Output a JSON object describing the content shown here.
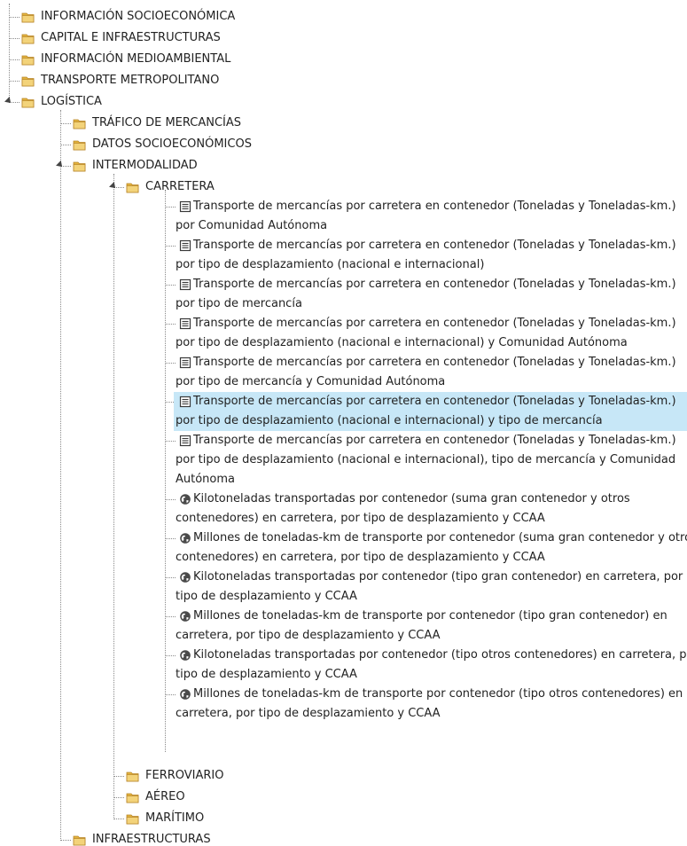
{
  "tree": {
    "top": [
      {
        "label": "INFORMACIÓN SOCIOECONÓMICA"
      },
      {
        "label": "CAPITAL E INFRAESTRUCTURAS"
      },
      {
        "label": "INFORMACIÓN MEDIOAMBIENTAL"
      },
      {
        "label": "TRANSPORTE METROPOLITANO"
      },
      {
        "label": "LOGÍSTICA"
      }
    ],
    "logistica": [
      {
        "label": "TRÁFICO DE MERCANCÍAS"
      },
      {
        "label": "DATOS SOCIOECONÓMICOS"
      },
      {
        "label": "INTERMODALIDAD"
      }
    ],
    "intermodalidad": [
      {
        "label": "CARRETERA"
      },
      {
        "label": "FERROVIARIO"
      },
      {
        "label": "AÉREO"
      },
      {
        "label": "MARÍTIMO"
      }
    ],
    "bottom": {
      "label": "INFRAESTRUCTURAS"
    },
    "carretera_items": [
      {
        "icon": "table-icon",
        "lines": [
          "Transporte de mercancías por carretera en contenedor (Toneladas y Toneladas-km.)",
          "por Comunidad Autónoma"
        ]
      },
      {
        "icon": "table-icon",
        "lines": [
          "Transporte de mercancías por carretera en contenedor (Toneladas y Toneladas-km.)",
          "por tipo de desplazamiento (nacional e internacional)"
        ]
      },
      {
        "icon": "table-icon",
        "lines": [
          "Transporte de mercancías por carretera en contenedor (Toneladas y Toneladas-km.)",
          "por tipo de mercancía"
        ]
      },
      {
        "icon": "table-icon",
        "lines": [
          "Transporte de mercancías por carretera en contenedor (Toneladas y Toneladas-km.)",
          "por tipo de desplazamiento (nacional e internacional) y Comunidad Autónoma"
        ]
      },
      {
        "icon": "table-icon",
        "lines": [
          "Transporte de mercancías por carretera en contenedor (Toneladas y Toneladas-km.)",
          "por tipo de mercancía y Comunidad Autónoma"
        ]
      },
      {
        "icon": "table-icon",
        "selected": true,
        "lines": [
          "Transporte de mercancías por carretera en contenedor (Toneladas y Toneladas-km.)",
          "por tipo de desplazamiento (nacional e internacional) y tipo de mercancía"
        ]
      },
      {
        "icon": "table-icon",
        "lines": [
          "Transporte de mercancías por carretera en contenedor (Toneladas y Toneladas-km.)",
          "por tipo de desplazamiento (nacional e internacional), tipo de mercancía y Comunidad",
          "Autónoma"
        ]
      },
      {
        "icon": "globe-icon",
        "lines": [
          "Kilotoneladas transportadas por contenedor (suma gran contenedor y otros",
          "contenedores) en carretera, por tipo de desplazamiento y CCAA"
        ]
      },
      {
        "icon": "globe-icon",
        "lines": [
          "Millones de toneladas-km de transporte por contenedor (suma gran contenedor y otros",
          "contenedores) en carretera, por tipo de desplazamiento y CCAA"
        ]
      },
      {
        "icon": "globe-icon",
        "lines": [
          "Kilotoneladas transportadas por contenedor (tipo gran contenedor) en carretera, por",
          "tipo de desplazamiento y CCAA"
        ]
      },
      {
        "icon": "globe-icon",
        "lines": [
          "Millones de toneladas-km de transporte por contenedor (tipo gran contenedor) en",
          "carretera, por tipo de desplazamiento y CCAA"
        ]
      },
      {
        "icon": "globe-icon",
        "lines": [
          "Kilotoneladas transportadas por contenedor (tipo otros contenedores) en carretera, por",
          "tipo de desplazamiento y CCAA"
        ]
      },
      {
        "icon": "globe-icon",
        "lines": [
          "Millones de toneladas-km de transporte por contenedor (tipo otros contenedores) en",
          "carretera, por tipo de desplazamiento y CCAA"
        ]
      }
    ],
    "colors": {
      "selected_bg": "#c7e7f7",
      "folder": "#e3b23c",
      "globe": "#4a4a4a"
    }
  }
}
